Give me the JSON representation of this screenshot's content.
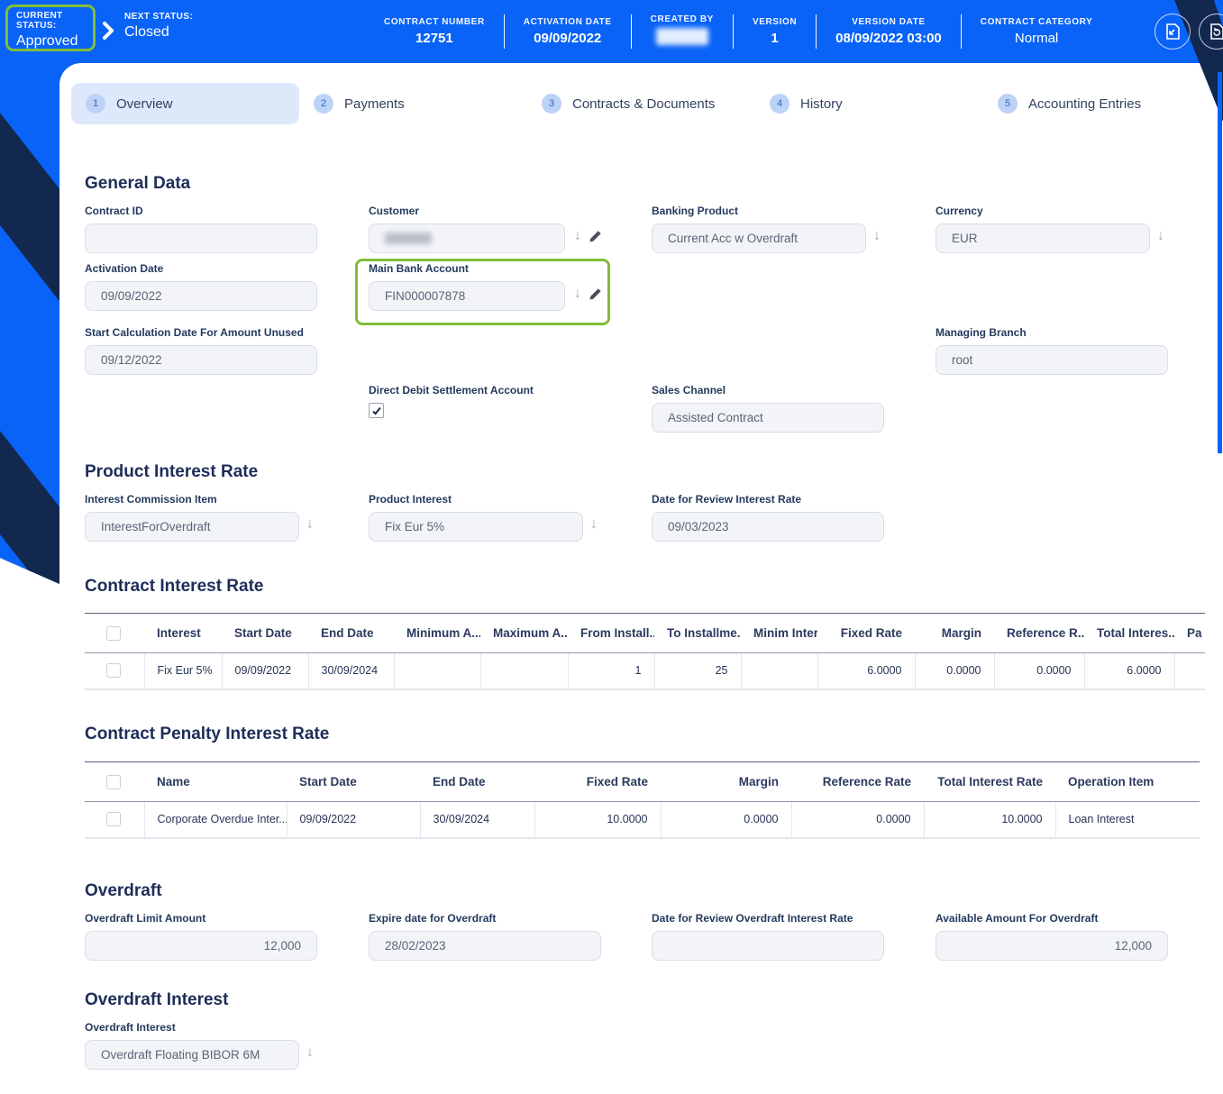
{
  "header": {
    "current_status": {
      "label": "CURRENT STATUS:",
      "value": "Approved"
    },
    "next_status": {
      "label": "NEXT STATUS:",
      "value": "Closed"
    },
    "fields": [
      {
        "label": "CONTRACT NUMBER",
        "value": "12751"
      },
      {
        "label": "ACTIVATION DATE",
        "value": "09/09/2022"
      },
      {
        "label": "CREATED BY",
        "value": "",
        "redacted": true
      },
      {
        "label": "VERSION",
        "value": "1"
      },
      {
        "label": "VERSION DATE",
        "value": "08/09/2022 03:00"
      },
      {
        "label": "CONTRACT CATEGORY",
        "value": "Normal"
      }
    ]
  },
  "tabs": [
    {
      "number": "1",
      "label": "Overview",
      "active": true
    },
    {
      "number": "2",
      "label": "Payments",
      "active": false
    },
    {
      "number": "3",
      "label": "Contracts & Documents",
      "active": false
    },
    {
      "number": "4",
      "label": "History",
      "active": false
    },
    {
      "number": "5",
      "label": "Accounting Entries",
      "active": false
    }
  ],
  "general_data": {
    "title": "General Data",
    "contract_id": {
      "label": "Contract ID",
      "value": ""
    },
    "customer": {
      "label": "Customer",
      "value": "",
      "redacted": true
    },
    "banking_product": {
      "label": "Banking Product",
      "value": "Current Acc w Overdraft"
    },
    "currency": {
      "label": "Currency",
      "value": "EUR"
    },
    "activation_date": {
      "label": "Activation Date",
      "value": "09/09/2022"
    },
    "main_bank_account": {
      "label": "Main Bank Account",
      "value": "FIN000007878"
    },
    "start_calc_date": {
      "label": "Start Calculation Date For Amount Unused",
      "value": "09/12/2022"
    },
    "managing_branch": {
      "label": "Managing Branch",
      "value": "root"
    },
    "direct_debit": {
      "label": "Direct Debit Settlement Account",
      "checked": true
    },
    "sales_channel": {
      "label": "Sales Channel",
      "value": "Assisted Contract"
    }
  },
  "product_interest_rate": {
    "title": "Product Interest Rate",
    "interest_commission_item": {
      "label": "Interest Commission Item",
      "value": "InterestForOverdraft"
    },
    "product_interest": {
      "label": "Product Interest",
      "value": "Fix Eur 5%"
    },
    "date_for_review": {
      "label": "Date for Review Interest Rate",
      "value": "09/03/2023"
    }
  },
  "contract_interest_rate": {
    "title": "Contract Interest Rate",
    "columns": [
      "Interest",
      "Start Date",
      "End Date",
      "Minimum A...",
      "Maximum A...",
      "From Install...",
      "To Installme...",
      "Minim Inter...",
      "Fixed Rate",
      "Margin",
      "Reference R...",
      "Total Interes...",
      "Pa"
    ],
    "rows": [
      [
        "Fix Eur 5%",
        "09/09/2022",
        "30/09/2024",
        "",
        "",
        "1",
        "25",
        "",
        "6.0000",
        "0.0000",
        "0.0000",
        "6.0000",
        ""
      ]
    ]
  },
  "contract_penalty_interest_rate": {
    "title": "Contract Penalty Interest Rate",
    "columns": [
      "Name",
      "Start Date",
      "End Date",
      "Fixed Rate",
      "Margin",
      "Reference Rate",
      "Total Interest Rate",
      "Operation Item"
    ],
    "rows": [
      [
        "Corporate Overdue Inter...",
        "09/09/2022",
        "30/09/2024",
        "10.0000",
        "0.0000",
        "0.0000",
        "10.0000",
        "Loan Interest"
      ]
    ]
  },
  "overdraft": {
    "title": "Overdraft",
    "limit_amount": {
      "label": "Overdraft Limit Amount",
      "value": "12,000"
    },
    "expire_date": {
      "label": "Expire date for Overdraft",
      "value": "28/02/2023"
    },
    "review_date": {
      "label": "Date for Review Overdraft Interest Rate",
      "value": ""
    },
    "available_amount": {
      "label": "Available Amount For Overdraft",
      "value": "12,000"
    }
  },
  "overdraft_interest": {
    "title": "Overdraft Interest",
    "field": {
      "label": "Overdraft Interest",
      "value": "Overdraft Floating BIBOR 6M"
    }
  },
  "colors": {
    "accent_blue": "#0a63f7",
    "navy": "#13284f",
    "highlight_green": "#82bd3a",
    "field_bg": "#f2f4f8"
  }
}
